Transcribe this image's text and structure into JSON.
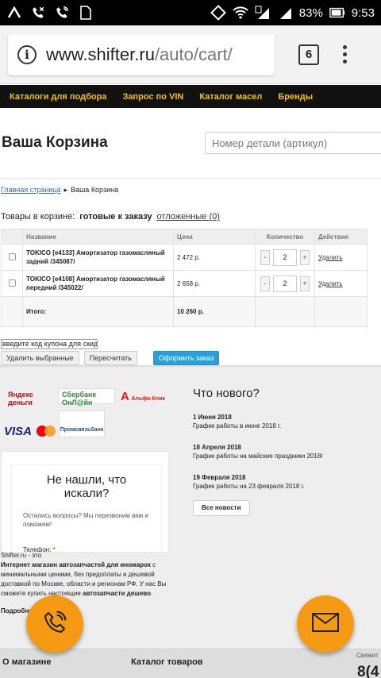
{
  "status_bar": {
    "battery": "83%",
    "time": "9:53"
  },
  "browser": {
    "url_host": "www.shifter.ru",
    "url_path": "/auto/cart/",
    "tab_count": "6"
  },
  "site_nav": [
    "Каталоги для подбора",
    "Запрос по VIN",
    "Каталог масел",
    "Бренды"
  ],
  "header": {
    "title": "Ваша Корзина",
    "search_placeholder": "Номер детали (артикул)"
  },
  "breadcrumb": {
    "home": "Главная страница",
    "current": "Ваша Корзина"
  },
  "cart_info": {
    "label": "Товары в корзине:",
    "ready": "готовые к заказу",
    "postponed": "отложенные (0)"
  },
  "cart_table": {
    "headers": [
      "Название",
      "Цена",
      "Количество",
      "Действия"
    ],
    "rows": [
      {
        "name": "TOKICO [e4133] Амортизатор газомасляный задний /345087/",
        "price": "2 472 р.",
        "qty": "2",
        "action": "Удалить"
      },
      {
        "name": "TOKICO [e4108] Амортизатор газомасляный передний /345022/",
        "price": "2 658 р.",
        "qty": "2",
        "action": "Удалить"
      }
    ],
    "total_label": "Итого:",
    "total_value": "10 260 р.",
    "minus": "-",
    "plus": "+"
  },
  "coupon_placeholder": "введите код купона для скидки",
  "buttons": {
    "delete_selected": "Удалить выбранные",
    "recalculate": "Пересчитать",
    "checkout": "Оформить заказ"
  },
  "payment_logos": {
    "yandex": "Яндекс деньги",
    "sber": "Сбербанк ОнЛ@йн",
    "alfa": "Альфа-Клик",
    "visa": "VISA",
    "mastercard": "MasterCard",
    "psb": "Промсвязьбанк"
  },
  "news": {
    "title": "Что нового?",
    "items": [
      {
        "date": "1 Июня 2018",
        "text": "График работы в июне 2018 г."
      },
      {
        "date": "18 Апреля 2018",
        "text": "График работы на майские праздники 2018г"
      },
      {
        "date": "19 Февраля 2018",
        "text": "График работы на 23 февраля 2018 г."
      }
    ],
    "all_button": "Все новости"
  },
  "callback_form": {
    "title": "Не нашли, что искали?",
    "subtitle": "Остались вопросы? Мы перезвоним вам и поможем!",
    "phone_label": "Телефон:",
    "required_mark": "*"
  },
  "about": {
    "line1": "Shifter.ru - это",
    "bold1": "Интернет магазин автозапчастей для иномарок",
    "text1": " с минимальными ценами, без предоплаты и дешевой доставкой по Москве, области и регионам РФ. У нас Вы сможете купить настоящие ",
    "bold2": "автозапчасти дешево",
    "text2": ".",
    "more": "Подробнее"
  },
  "bottom_nav": {
    "about": "О магазине",
    "catalog": "Каталог товаров",
    "contact": "Свяжит",
    "phone": "8(4"
  },
  "colors": {
    "fab": "#f79a13",
    "nav_link": "#f5c400",
    "primary_button": "#2ba0d8"
  }
}
